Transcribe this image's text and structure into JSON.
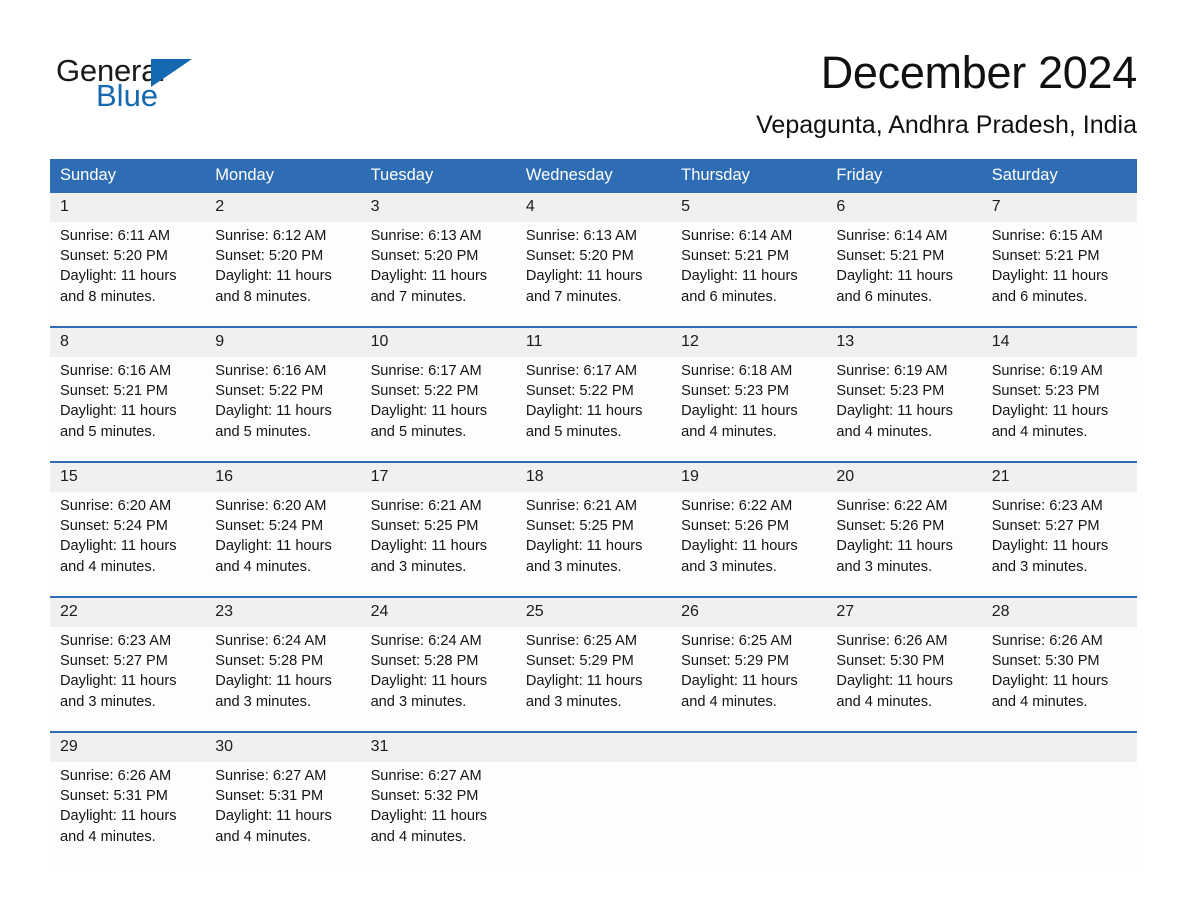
{
  "logo": {
    "word_one": "General",
    "word_two": "Blue",
    "triangle_color": "#1569b0",
    "text_color": "#1a1a1a"
  },
  "header": {
    "title": "December 2024",
    "subtitle": "Vepagunta, Andhra Pradesh, India"
  },
  "theme": {
    "header_blue": "#2e6db4",
    "daynum_band": "#f0f0f0",
    "cell_bg": "#fdfdfd"
  },
  "calendar": {
    "weekday_headers": [
      "Sunday",
      "Monday",
      "Tuesday",
      "Wednesday",
      "Thursday",
      "Friday",
      "Saturday"
    ],
    "weeks": [
      {
        "daynums": [
          "1",
          "2",
          "3",
          "4",
          "5",
          "6",
          "7"
        ],
        "cells": [
          {
            "sunrise": "Sunrise: 6:11 AM",
            "sunset": "Sunset: 5:20 PM",
            "daylight_1": "Daylight: 11 hours",
            "daylight_2": "and 8 minutes."
          },
          {
            "sunrise": "Sunrise: 6:12 AM",
            "sunset": "Sunset: 5:20 PM",
            "daylight_1": "Daylight: 11 hours",
            "daylight_2": "and 8 minutes."
          },
          {
            "sunrise": "Sunrise: 6:13 AM",
            "sunset": "Sunset: 5:20 PM",
            "daylight_1": "Daylight: 11 hours",
            "daylight_2": "and 7 minutes."
          },
          {
            "sunrise": "Sunrise: 6:13 AM",
            "sunset": "Sunset: 5:20 PM",
            "daylight_1": "Daylight: 11 hours",
            "daylight_2": "and 7 minutes."
          },
          {
            "sunrise": "Sunrise: 6:14 AM",
            "sunset": "Sunset: 5:21 PM",
            "daylight_1": "Daylight: 11 hours",
            "daylight_2": "and 6 minutes."
          },
          {
            "sunrise": "Sunrise: 6:14 AM",
            "sunset": "Sunset: 5:21 PM",
            "daylight_1": "Daylight: 11 hours",
            "daylight_2": "and 6 minutes."
          },
          {
            "sunrise": "Sunrise: 6:15 AM",
            "sunset": "Sunset: 5:21 PM",
            "daylight_1": "Daylight: 11 hours",
            "daylight_2": "and 6 minutes."
          }
        ]
      },
      {
        "daynums": [
          "8",
          "9",
          "10",
          "11",
          "12",
          "13",
          "14"
        ],
        "cells": [
          {
            "sunrise": "Sunrise: 6:16 AM",
            "sunset": "Sunset: 5:21 PM",
            "daylight_1": "Daylight: 11 hours",
            "daylight_2": "and 5 minutes."
          },
          {
            "sunrise": "Sunrise: 6:16 AM",
            "sunset": "Sunset: 5:22 PM",
            "daylight_1": "Daylight: 11 hours",
            "daylight_2": "and 5 minutes."
          },
          {
            "sunrise": "Sunrise: 6:17 AM",
            "sunset": "Sunset: 5:22 PM",
            "daylight_1": "Daylight: 11 hours",
            "daylight_2": "and 5 minutes."
          },
          {
            "sunrise": "Sunrise: 6:17 AM",
            "sunset": "Sunset: 5:22 PM",
            "daylight_1": "Daylight: 11 hours",
            "daylight_2": "and 5 minutes."
          },
          {
            "sunrise": "Sunrise: 6:18 AM",
            "sunset": "Sunset: 5:23 PM",
            "daylight_1": "Daylight: 11 hours",
            "daylight_2": "and 4 minutes."
          },
          {
            "sunrise": "Sunrise: 6:19 AM",
            "sunset": "Sunset: 5:23 PM",
            "daylight_1": "Daylight: 11 hours",
            "daylight_2": "and 4 minutes."
          },
          {
            "sunrise": "Sunrise: 6:19 AM",
            "sunset": "Sunset: 5:23 PM",
            "daylight_1": "Daylight: 11 hours",
            "daylight_2": "and 4 minutes."
          }
        ]
      },
      {
        "daynums": [
          "15",
          "16",
          "17",
          "18",
          "19",
          "20",
          "21"
        ],
        "cells": [
          {
            "sunrise": "Sunrise: 6:20 AM",
            "sunset": "Sunset: 5:24 PM",
            "daylight_1": "Daylight: 11 hours",
            "daylight_2": "and 4 minutes."
          },
          {
            "sunrise": "Sunrise: 6:20 AM",
            "sunset": "Sunset: 5:24 PM",
            "daylight_1": "Daylight: 11 hours",
            "daylight_2": "and 4 minutes."
          },
          {
            "sunrise": "Sunrise: 6:21 AM",
            "sunset": "Sunset: 5:25 PM",
            "daylight_1": "Daylight: 11 hours",
            "daylight_2": "and 3 minutes."
          },
          {
            "sunrise": "Sunrise: 6:21 AM",
            "sunset": "Sunset: 5:25 PM",
            "daylight_1": "Daylight: 11 hours",
            "daylight_2": "and 3 minutes."
          },
          {
            "sunrise": "Sunrise: 6:22 AM",
            "sunset": "Sunset: 5:26 PM",
            "daylight_1": "Daylight: 11 hours",
            "daylight_2": "and 3 minutes."
          },
          {
            "sunrise": "Sunrise: 6:22 AM",
            "sunset": "Sunset: 5:26 PM",
            "daylight_1": "Daylight: 11 hours",
            "daylight_2": "and 3 minutes."
          },
          {
            "sunrise": "Sunrise: 6:23 AM",
            "sunset": "Sunset: 5:27 PM",
            "daylight_1": "Daylight: 11 hours",
            "daylight_2": "and 3 minutes."
          }
        ]
      },
      {
        "daynums": [
          "22",
          "23",
          "24",
          "25",
          "26",
          "27",
          "28"
        ],
        "cells": [
          {
            "sunrise": "Sunrise: 6:23 AM",
            "sunset": "Sunset: 5:27 PM",
            "daylight_1": "Daylight: 11 hours",
            "daylight_2": "and 3 minutes."
          },
          {
            "sunrise": "Sunrise: 6:24 AM",
            "sunset": "Sunset: 5:28 PM",
            "daylight_1": "Daylight: 11 hours",
            "daylight_2": "and 3 minutes."
          },
          {
            "sunrise": "Sunrise: 6:24 AM",
            "sunset": "Sunset: 5:28 PM",
            "daylight_1": "Daylight: 11 hours",
            "daylight_2": "and 3 minutes."
          },
          {
            "sunrise": "Sunrise: 6:25 AM",
            "sunset": "Sunset: 5:29 PM",
            "daylight_1": "Daylight: 11 hours",
            "daylight_2": "and 3 minutes."
          },
          {
            "sunrise": "Sunrise: 6:25 AM",
            "sunset": "Sunset: 5:29 PM",
            "daylight_1": "Daylight: 11 hours",
            "daylight_2": "and 4 minutes."
          },
          {
            "sunrise": "Sunrise: 6:26 AM",
            "sunset": "Sunset: 5:30 PM",
            "daylight_1": "Daylight: 11 hours",
            "daylight_2": "and 4 minutes."
          },
          {
            "sunrise": "Sunrise: 6:26 AM",
            "sunset": "Sunset: 5:30 PM",
            "daylight_1": "Daylight: 11 hours",
            "daylight_2": "and 4 minutes."
          }
        ]
      },
      {
        "daynums": [
          "29",
          "30",
          "31",
          "",
          "",
          "",
          ""
        ],
        "cells": [
          {
            "sunrise": "Sunrise: 6:26 AM",
            "sunset": "Sunset: 5:31 PM",
            "daylight_1": "Daylight: 11 hours",
            "daylight_2": "and 4 minutes."
          },
          {
            "sunrise": "Sunrise: 6:27 AM",
            "sunset": "Sunset: 5:31 PM",
            "daylight_1": "Daylight: 11 hours",
            "daylight_2": "and 4 minutes."
          },
          {
            "sunrise": "Sunrise: 6:27 AM",
            "sunset": "Sunset: 5:32 PM",
            "daylight_1": "Daylight: 11 hours",
            "daylight_2": "and 4 minutes."
          },
          {
            "sunrise": "",
            "sunset": "",
            "daylight_1": "",
            "daylight_2": ""
          },
          {
            "sunrise": "",
            "sunset": "",
            "daylight_1": "",
            "daylight_2": ""
          },
          {
            "sunrise": "",
            "sunset": "",
            "daylight_1": "",
            "daylight_2": ""
          },
          {
            "sunrise": "",
            "sunset": "",
            "daylight_1": "",
            "daylight_2": ""
          }
        ]
      }
    ]
  }
}
